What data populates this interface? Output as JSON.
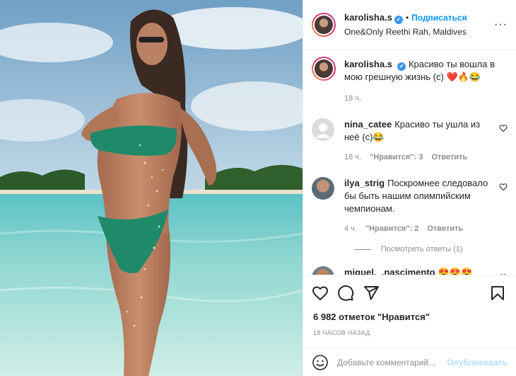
{
  "post": {
    "image_alt": "Beach photo"
  },
  "header": {
    "username": "karolisha.s",
    "verified_mark": "✔",
    "separator": "•",
    "follow_label": "Подписаться",
    "location": "One&Only Reethi Rah, Maldives",
    "more_label": "···"
  },
  "caption": {
    "username": "karolisha.s",
    "text": "Красиво ты вошла в мою грешную жизнь (с) ❤️🔥😂",
    "time": "18 ч."
  },
  "comments": [
    {
      "username": "nina_catee",
      "text": "Красиво ты ушла из неё (с)😂",
      "time": "18 ч.",
      "likes": "\"Нравится\": 3",
      "reply": "Ответить"
    },
    {
      "username": "ilya_strig",
      "text": "Поскромнее следовало бы быть нашим олимпийским чемпионам.",
      "time": "4 ч.",
      "likes": "\"Нравится\": 2",
      "reply": "Ответить"
    },
    {
      "username": "miguel._.nascimento",
      "text": "😍😍😍"
    }
  ],
  "replies_label": "Посмотреть ответы (1)",
  "likes_text": "6 982 отметок \"Нравится\"",
  "timestamp": "18 ЧАСОВ НАЗАД",
  "add_comment": {
    "placeholder": "Добавьте комментарий...",
    "post_label": "Опубликовать"
  },
  "colors": {
    "accent": "#0095f6",
    "verified": "#3897f0",
    "muted": "#8e8e8e",
    "post_disabled": "#b2dffc"
  },
  "icons": [
    "like-icon",
    "comment-icon",
    "share-icon",
    "save-icon",
    "emoji-icon",
    "more-icon"
  ]
}
